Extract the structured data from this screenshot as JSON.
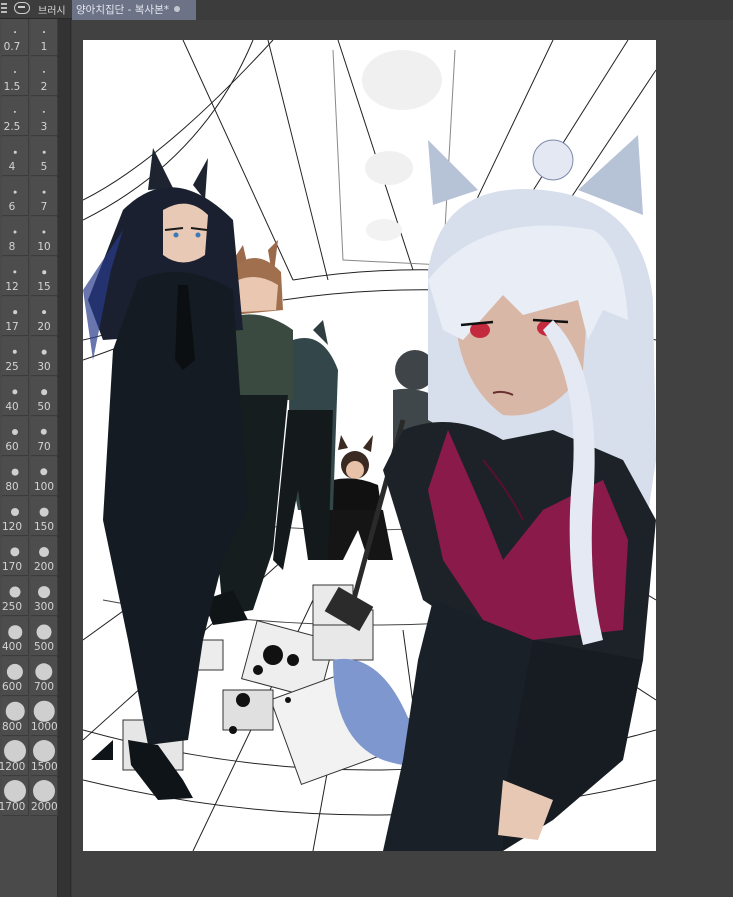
{
  "brush_panel": {
    "title": "브러시",
    "sizes": [
      "0.7",
      "1",
      "1.5",
      "2",
      "2.5",
      "3",
      "4",
      "5",
      "6",
      "7",
      "8",
      "10",
      "12",
      "15",
      "17",
      "20",
      "25",
      "30",
      "40",
      "50",
      "60",
      "70",
      "80",
      "100",
      "120",
      "150",
      "170",
      "200",
      "250",
      "300",
      "400",
      "500",
      "600",
      "700",
      "800",
      "1000",
      "1200",
      "1500",
      "1700",
      "2000"
    ],
    "labels": [
      "0.7",
      "1",
      "1.5",
      "2",
      "2.5",
      "3",
      "4",
      "5",
      "6",
      "7",
      "8",
      "10",
      "12",
      "15",
      "17",
      "20",
      "25",
      "30",
      "40",
      "50",
      "60",
      "70",
      "80",
      "100",
      "120",
      "150",
      "170",
      "200",
      "250",
      "300",
      "400",
      "500",
      "600",
      "700",
      "800",
      "1000",
      "1200",
      "1500",
      "1700",
      "2000"
    ]
  },
  "document_tab": {
    "title": "양아치집단 - 복사본*"
  },
  "colors": {
    "panel_bg": "#4a4a4a",
    "workspace_bg": "#414141",
    "tab_active": "#6c7387",
    "canvas_bg": "#ffffff"
  },
  "canvas": {
    "description_icon": "illustration-artwork"
  }
}
